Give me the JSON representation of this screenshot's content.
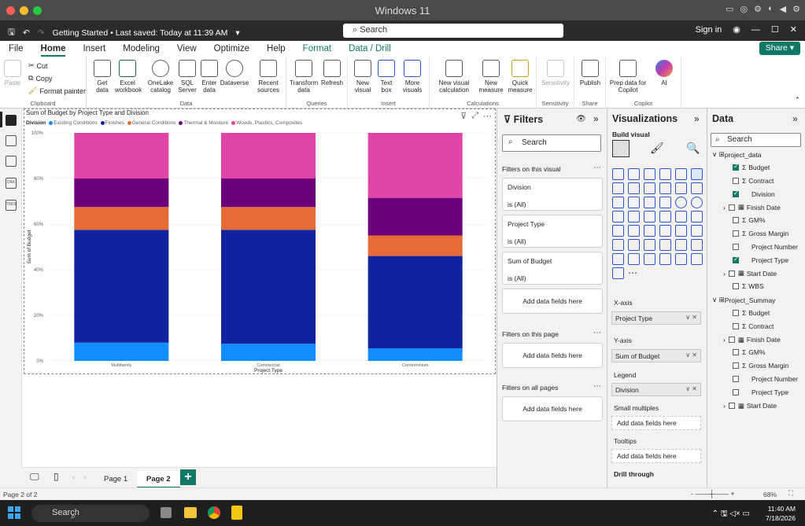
{
  "mac": {
    "title": "Windows 11"
  },
  "titlebar": {
    "doc": "Getting Started • Last saved: Today at 11:39 AM",
    "search": "Search",
    "signin": "Sign in"
  },
  "menu": {
    "tabs": [
      "File",
      "Home",
      "Insert",
      "Modeling",
      "View",
      "Optimize",
      "Help",
      "Format",
      "Data / Drill"
    ],
    "share": "Share"
  },
  "ribbon": {
    "clipboard": {
      "paste": "Paste",
      "cut": "Cut",
      "copy": "Copy",
      "format_painter": "Format painter",
      "group": "Clipboard"
    },
    "data": {
      "get": "Get data",
      "excel": "Excel workbook",
      "onelake": "OneLake catalog",
      "sql": "SQL Server",
      "enter": "Enter data",
      "dataverse": "Dataverse",
      "recent": "Recent sources",
      "group": "Data"
    },
    "queries": {
      "transform": "Transform data",
      "refresh": "Refresh",
      "group": "Queries"
    },
    "insert": {
      "new_visual": "New visual",
      "text_box": "Text box",
      "more": "More visuals",
      "group": "Insert"
    },
    "calculations": {
      "new_visual_calc": "New visual calculation",
      "new_measure": "New measure",
      "quick": "Quick measure",
      "group": "Calculations"
    },
    "sensitivity": {
      "label": "Sensitivity",
      "group": "Sensitivity"
    },
    "share": {
      "publish": "Publish",
      "group": "Share"
    },
    "copilot": {
      "prep": "Prep data for Copilot",
      "ai": "AI",
      "group": "Copilot"
    }
  },
  "visual": {
    "title": "Sum of Budget by Project Type and Division",
    "legend_title": "Division"
  },
  "chart_data": {
    "type": "bar",
    "stacked": "100%",
    "title": "Sum of Budget by Project Type and Division",
    "xlabel": "Project Type",
    "ylabel": "Sum of Budget",
    "categories": [
      "Multifamily",
      "Commercial",
      "Condominium"
    ],
    "yticks": [
      "0%",
      "20%",
      "40%",
      "60%",
      "80%",
      "100%"
    ],
    "ylim": [
      0,
      100
    ],
    "series": [
      {
        "name": "Existing Conditions",
        "color": "#118dff",
        "values": [
          8,
          7.5,
          5.5
        ]
      },
      {
        "name": "Finishes",
        "color": "#12239e",
        "values": [
          49.5,
          50,
          40.5
        ]
      },
      {
        "name": "General Conditions",
        "color": "#e66c37",
        "values": [
          10,
          10,
          9
        ]
      },
      {
        "name": "Thermal & Moisture",
        "color": "#6b007b",
        "values": [
          12.5,
          12.5,
          16.5
        ]
      },
      {
        "name": "Woods, Plastics, Composites",
        "color": "#e044a7",
        "values": [
          20,
          20,
          28.5
        ]
      }
    ]
  },
  "pages": {
    "tabs": [
      "Page 1",
      "Page 2"
    ],
    "add": "+"
  },
  "status": {
    "page": "Page 2 of 2",
    "zoom": "68%"
  },
  "filters": {
    "title": "Filters",
    "search": "Search",
    "on_visual": "Filters on this visual",
    "cards": [
      {
        "name": "Division",
        "value": "is (All)"
      },
      {
        "name": "Project Type",
        "value": "is (All)"
      },
      {
        "name": "Sum of Budget",
        "value": "is (All)"
      }
    ],
    "add": "Add data fields here",
    "on_page": "Filters on this page",
    "on_all": "Filters on all pages"
  },
  "viz": {
    "title": "Visualizations",
    "build": "Build visual",
    "xaxis": "X-axis",
    "xaxis_field": "Project Type",
    "yaxis": "Y-axis",
    "yaxis_field": "Sum of Budget",
    "legend": "Legend",
    "legend_field": "Division",
    "small_multiples": "Small multiples",
    "add": "Add data fields here",
    "tooltips": "Tooltips",
    "drill": "Drill through"
  },
  "data": {
    "title": "Data",
    "search": "Search",
    "tables": [
      {
        "name": "project_data",
        "fields": [
          {
            "name": "Budget",
            "sigma": true,
            "checked": true
          },
          {
            "name": "Contract",
            "sigma": true,
            "checked": false
          },
          {
            "name": "Division",
            "sigma": false,
            "checked": true
          },
          {
            "name": "Finish Date",
            "sigma": false,
            "checked": false,
            "expand": true
          },
          {
            "name": "GM%",
            "sigma": true,
            "checked": false
          },
          {
            "name": "Gross Margin",
            "sigma": true,
            "checked": false
          },
          {
            "name": "Project Number",
            "sigma": false,
            "checked": false
          },
          {
            "name": "Project Type",
            "sigma": false,
            "checked": true
          },
          {
            "name": "Start Date",
            "sigma": false,
            "checked": false,
            "expand": true
          },
          {
            "name": "WBS",
            "sigma": true,
            "checked": false
          }
        ]
      },
      {
        "name": "Project_Summay",
        "fields": [
          {
            "name": "Budget",
            "sigma": true,
            "checked": false
          },
          {
            "name": "Contract",
            "sigma": true,
            "checked": false
          },
          {
            "name": "Finish Date",
            "sigma": false,
            "checked": false,
            "expand": true
          },
          {
            "name": "GM%",
            "sigma": true,
            "checked": false
          },
          {
            "name": "Gross Margin",
            "sigma": true,
            "checked": false
          },
          {
            "name": "Project Number",
            "sigma": false,
            "checked": false
          },
          {
            "name": "Project Type",
            "sigma": false,
            "checked": false
          },
          {
            "name": "Start Date",
            "sigma": false,
            "checked": false,
            "expand": true
          }
        ]
      }
    ]
  },
  "taskbar": {
    "search": "Search",
    "time": "11:40 AM",
    "date": "7/18/2026"
  }
}
